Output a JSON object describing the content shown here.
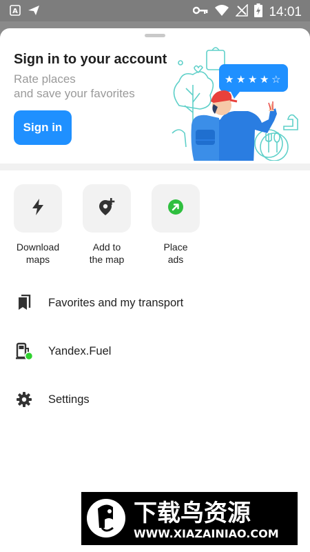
{
  "status_bar": {
    "time": "14:01",
    "left_icons": [
      "a-box-icon",
      "send-icon"
    ],
    "right_icons": [
      "key-icon",
      "wifi-icon",
      "no-signal-icon",
      "battery-charging-icon"
    ]
  },
  "signin": {
    "title": "Sign in to your account",
    "subtitle_line1": "Rate places",
    "subtitle_line2": "and save your favorites",
    "button_label": "Sign in",
    "accent_color": "#1f90ff",
    "illustration_rating_stars": 5
  },
  "quick_actions": [
    {
      "label_line1": "Download",
      "label_line2": "maps",
      "icon": "lightning-icon"
    },
    {
      "label_line1": "Add to",
      "label_line2": "the map",
      "icon": "add-place-icon"
    },
    {
      "label_line1": "Place",
      "label_line2": "ads",
      "icon": "ads-arrow-icon"
    }
  ],
  "menu": [
    {
      "label": "Favorites and my transport",
      "icon": "bookmarks-icon"
    },
    {
      "label": "Yandex.Fuel",
      "icon": "fuel-pump-icon"
    },
    {
      "label": "Settings",
      "icon": "gear-icon"
    }
  ],
  "watermark": {
    "title": "下载鸟资源",
    "url": "WWW.XIAZAINIAO.COM"
  }
}
